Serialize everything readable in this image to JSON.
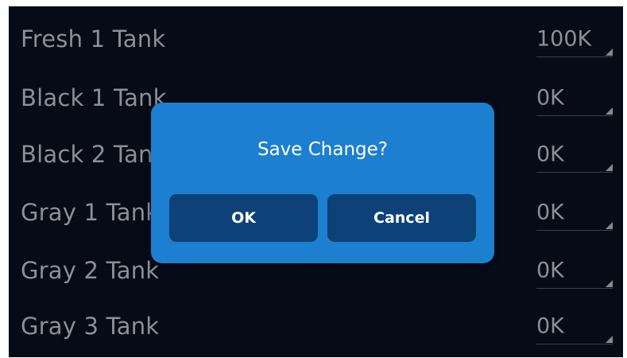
{
  "tanks": [
    {
      "label": "Fresh 1 Tank",
      "value": "100K"
    },
    {
      "label": "Black 1 Tank",
      "value": "0K"
    },
    {
      "label": "Black 2 Tank",
      "value": "0K"
    },
    {
      "label": "Gray 1 Tank",
      "value": "0K"
    },
    {
      "label": "Gray 2 Tank",
      "value": "0K"
    },
    {
      "label": "Gray 3 Tank",
      "value": "0K"
    }
  ],
  "dialog": {
    "title": "Save Change?",
    "ok_label": "OK",
    "cancel_label": "Cancel"
  },
  "colors": {
    "background": "#050b17",
    "dialog": "#1d7fcf",
    "dialog_button": "#0c4277",
    "text_dim": "#8b9097"
  }
}
